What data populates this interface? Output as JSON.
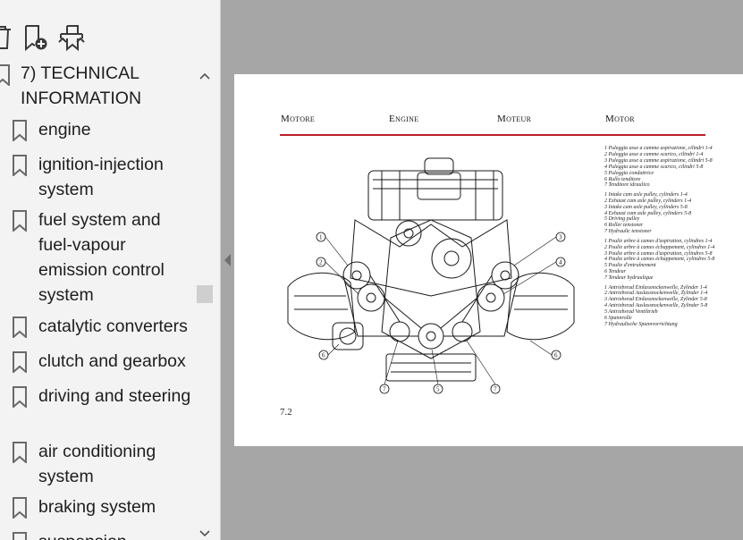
{
  "colors": {
    "sidebar_bg": "#f3f3f3",
    "viewer_bg": "#a6a6a6",
    "page_bg": "#ffffff",
    "header_rule": "#b8202a"
  },
  "toolbar": {
    "icons": [
      "delete-bookmark-icon",
      "add-bookmark-icon",
      "expand-bookmark-icon"
    ]
  },
  "outline": {
    "items": [
      {
        "label": "7) TECHNICAL INFORMATION"
      },
      {
        "label": "engine"
      },
      {
        "label": "ignition-injection system"
      },
      {
        "label": "fuel system and fuel-vapour emission control system"
      },
      {
        "label": "catalytic converters"
      },
      {
        "label": "clutch and gearbox"
      },
      {
        "label": "driving and steering"
      },
      {
        "label": "air conditioning system"
      },
      {
        "label": "braking system"
      },
      {
        "label": "suspension"
      }
    ]
  },
  "page": {
    "headers": [
      "Motore",
      "Engine",
      "Moteur",
      "Motor"
    ],
    "page_number": "7.2",
    "legend": [
      [
        "1 Puleggia asse a camme aspirazione, cilindri 1-4",
        "2 Puleggia asse a camme scarico, cilindri 1-4",
        "3 Puleggia asse a camme aspirazione, cilindri 5-8",
        "4 Puleggia asse a camme scarico, cilindri 5-8",
        "5 Puleggia conduttrice",
        "6 Rullo tenditore",
        "7 Tenditore idraulico"
      ],
      [
        "1 Intake cam axle pulley, cylinders 1-4",
        "2 Exhaust cam axle pulley, cylinders 1-4",
        "3 Intake cam axle pulley, cylinders 5-8",
        "4 Exhaust cam axle pulley, cylinders 5-8",
        "5 Driving pulley",
        "6 Roller tensioner",
        "7 Hydraulic tensioner"
      ],
      [
        "1 Poulie arbre à cames d'aspiration, cylindres 1-4",
        "2 Poulie arbre à cames échappement, cylindres 1-4",
        "3 Poulie arbre à cames d'aspiration, cylindres 5-8",
        "4 Poulie arbre à cames échappement, cylindres 5-8",
        "5 Poulie d'entraînement",
        "6 Tendeur",
        "7 Tendeur hydraulique"
      ],
      [
        "1 Antriebsrad Einlassnockenwelle, Zylinder 1-4",
        "2 Antriebsrad Auslassnockenwelle, Zylinder 1-4",
        "3 Antriebsrad Einlassnockenwelle, Zylinder 5-8",
        "4 Antriebsrad Auslassnockenwelle, Zylinder 5-8",
        "5 Antriebsrad Ventiltrieb",
        "6 Spannrolle",
        "7 Hydraulische Spannvorrichtung"
      ]
    ],
    "callouts": [
      "1",
      "2",
      "3",
      "4",
      "5",
      "6",
      "7"
    ]
  }
}
